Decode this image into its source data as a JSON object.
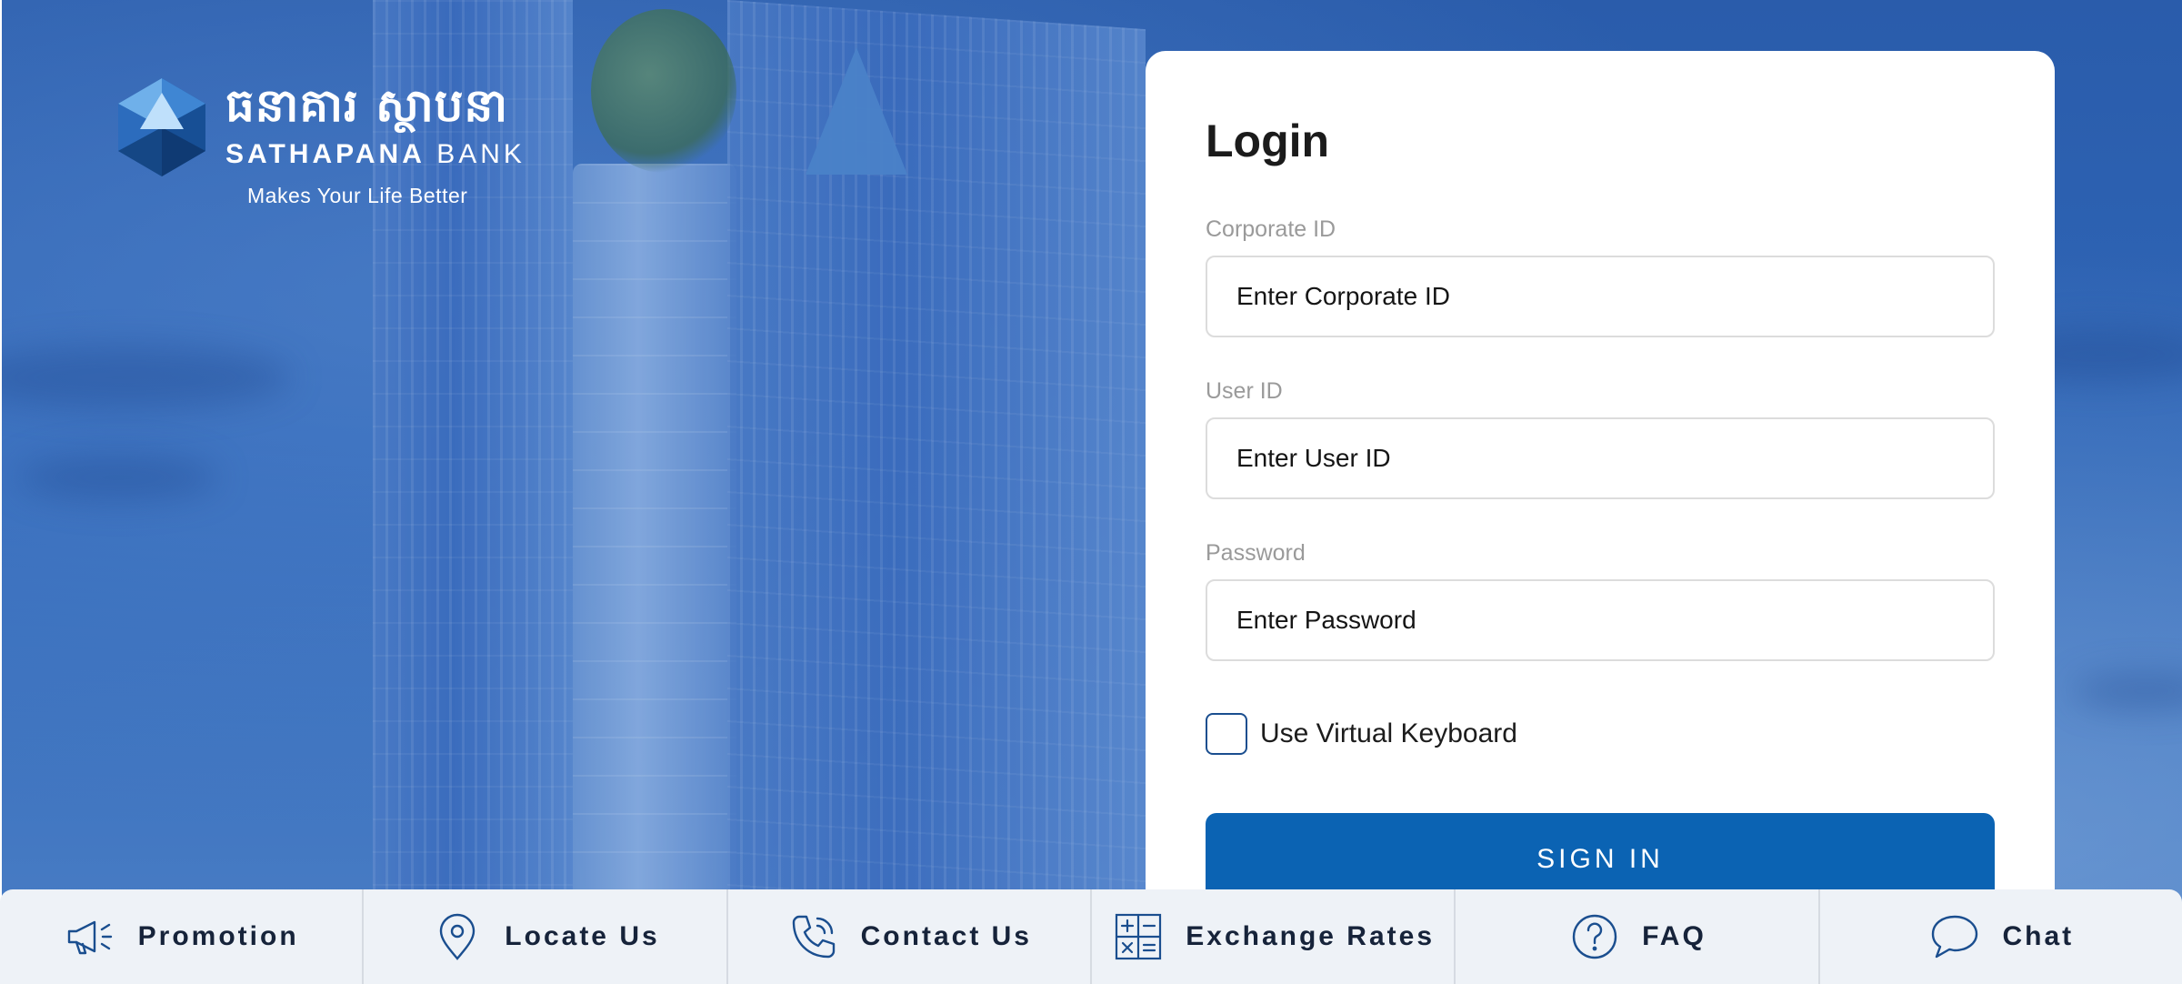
{
  "brand": {
    "khmer_name": "ធនាគារ ស្ថាបនា",
    "name_bold": "SATHAPANA",
    "name_regular": "BANK",
    "tagline": "Makes Your Life Better"
  },
  "login": {
    "title": "Login",
    "fields": [
      {
        "label": "Corporate ID",
        "placeholder": "Enter Corporate ID",
        "value": ""
      },
      {
        "label": "User ID",
        "placeholder": "Enter User ID",
        "value": ""
      },
      {
        "label": "Password",
        "placeholder": "Enter Password",
        "value": ""
      }
    ],
    "virtual_keyboard": {
      "label": "Use Virtual Keyboard",
      "checked": false
    },
    "submit_label": "SIGN IN"
  },
  "bottom_nav": [
    {
      "label": "Promotion",
      "icon": "megaphone-icon"
    },
    {
      "label": "Locate Us",
      "icon": "location-pin-icon"
    },
    {
      "label": "Contact Us",
      "icon": "phone-icon"
    },
    {
      "label": "Exchange Rates",
      "icon": "calculator-icon"
    },
    {
      "label": "FAQ",
      "icon": "question-icon"
    },
    {
      "label": "Chat",
      "icon": "chat-bubble-icon"
    }
  ],
  "colors": {
    "primary": "#0b63b3",
    "nav_text": "#16233a",
    "icon": "#1a4e8f",
    "background": "#2f62b0"
  }
}
